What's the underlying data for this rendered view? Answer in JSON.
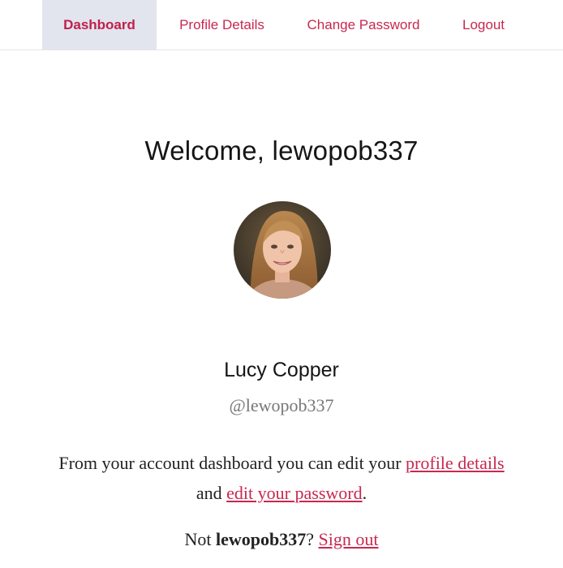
{
  "nav": {
    "tabs": [
      {
        "label": "Dashboard",
        "active": true
      },
      {
        "label": "Profile Details",
        "active": false
      },
      {
        "label": "Change Password",
        "active": false
      },
      {
        "label": "Logout",
        "active": false
      }
    ]
  },
  "dashboard": {
    "welcome": "Welcome, lewopob337",
    "avatar_icon": "user-avatar-photo",
    "full_name": "Lucy Copper",
    "handle": "@lewopob337",
    "intro_prefix": "From your account dashboard you can edit your",
    "profile_link": "profile details",
    "intro_middle": "and",
    "password_link": "edit your password",
    "intro_suffix": ".",
    "not_prefix": "Not",
    "not_user": "lewopob337",
    "not_question": "?",
    "signout_link": "Sign out"
  },
  "colors": {
    "accent": "#c8284f",
    "active_tab_bg": "#e2e4ee",
    "handle_gray": "#777777"
  }
}
